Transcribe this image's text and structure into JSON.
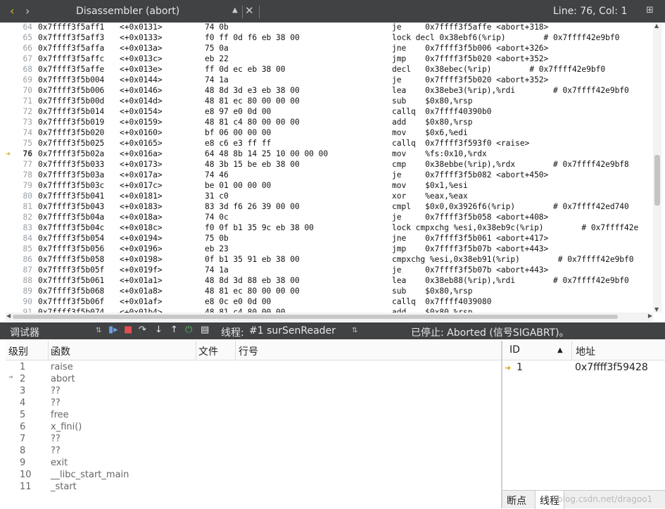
{
  "editor": {
    "title": "Disassembler (abort)",
    "position": "Line: 76, Col: 1",
    "rows": [
      {
        "ln": "64",
        "addr": "0x7ffff3f5aff1",
        "off": "<+0x0131>",
        "bytes": "74 0b",
        "ins": "je     0x7ffff3f5affe <abort+318>"
      },
      {
        "ln": "65",
        "addr": "0x7ffff3f5aff3",
        "off": "<+0x0133>",
        "bytes": "f0 ff 0d f6 eb 38 00",
        "ins": "lock decl 0x38ebf6(%rip)        # 0x7ffff42e9bf0"
      },
      {
        "ln": "66",
        "addr": "0x7ffff3f5affa",
        "off": "<+0x013a>",
        "bytes": "75 0a",
        "ins": "jne    0x7ffff3f5b006 <abort+326>"
      },
      {
        "ln": "67",
        "addr": "0x7ffff3f5affc",
        "off": "<+0x013c>",
        "bytes": "eb 22",
        "ins": "jmp    0x7ffff3f5b020 <abort+352>"
      },
      {
        "ln": "68",
        "addr": "0x7ffff3f5affe",
        "off": "<+0x013e>",
        "bytes": "ff 0d ec eb 38 00",
        "ins": "decl   0x38ebec(%rip)        # 0x7ffff42e9bf0"
      },
      {
        "ln": "69",
        "addr": "0x7ffff3f5b004",
        "off": "<+0x0144>",
        "bytes": "74 1a",
        "ins": "je     0x7ffff3f5b020 <abort+352>"
      },
      {
        "ln": "70",
        "addr": "0x7ffff3f5b006",
        "off": "<+0x0146>",
        "bytes": "48 8d 3d e3 eb 38 00",
        "ins": "lea    0x38ebe3(%rip),%rdi        # 0x7ffff42e9bf0"
      },
      {
        "ln": "71",
        "addr": "0x7ffff3f5b00d",
        "off": "<+0x014d>",
        "bytes": "48 81 ec 80 00 00 00",
        "ins": "sub    $0x80,%rsp"
      },
      {
        "ln": "72",
        "addr": "0x7ffff3f5b014",
        "off": "<+0x0154>",
        "bytes": "e8 97 e0 0d 00",
        "ins": "callq  0x7ffff40390b0"
      },
      {
        "ln": "73",
        "addr": "0x7ffff3f5b019",
        "off": "<+0x0159>",
        "bytes": "48 81 c4 80 00 00 00",
        "ins": "add    $0x80,%rsp"
      },
      {
        "ln": "74",
        "addr": "0x7ffff3f5b020",
        "off": "<+0x0160>",
        "bytes": "bf 06 00 00 00",
        "ins": "mov    $0x6,%edi"
      },
      {
        "ln": "75",
        "addr": "0x7ffff3f5b025",
        "off": "<+0x0165>",
        "bytes": "e8 c6 e3 ff ff",
        "ins": "callq  0x7ffff3f593f0 <raise>"
      },
      {
        "ln": "76",
        "addr": "0x7ffff3f5b02a",
        "off": "<+0x016a>",
        "bytes": "64 48 8b 14 25 10 00 00 00",
        "ins": "mov    %fs:0x10,%rdx"
      },
      {
        "ln": "77",
        "addr": "0x7ffff3f5b033",
        "off": "<+0x0173>",
        "bytes": "48 3b 15 be eb 38 00",
        "ins": "cmp    0x38ebbe(%rip),%rdx        # 0x7ffff42e9bf8"
      },
      {
        "ln": "78",
        "addr": "0x7ffff3f5b03a",
        "off": "<+0x017a>",
        "bytes": "74 46",
        "ins": "je     0x7ffff3f5b082 <abort+450>"
      },
      {
        "ln": "79",
        "addr": "0x7ffff3f5b03c",
        "off": "<+0x017c>",
        "bytes": "be 01 00 00 00",
        "ins": "mov    $0x1,%esi"
      },
      {
        "ln": "80",
        "addr": "0x7ffff3f5b041",
        "off": "<+0x0181>",
        "bytes": "31 c0",
        "ins": "xor    %eax,%eax"
      },
      {
        "ln": "81",
        "addr": "0x7ffff3f5b043",
        "off": "<+0x0183>",
        "bytes": "83 3d f6 26 39 00 00",
        "ins": "cmpl   $0x0,0x3926f6(%rip)        # 0x7ffff42ed740"
      },
      {
        "ln": "82",
        "addr": "0x7ffff3f5b04a",
        "off": "<+0x018a>",
        "bytes": "74 0c",
        "ins": "je     0x7ffff3f5b058 <abort+408>"
      },
      {
        "ln": "83",
        "addr": "0x7ffff3f5b04c",
        "off": "<+0x018c>",
        "bytes": "f0 0f b1 35 9c eb 38 00",
        "ins": "lock cmpxchg %esi,0x38eb9c(%rip)        # 0x7ffff42e"
      },
      {
        "ln": "84",
        "addr": "0x7ffff3f5b054",
        "off": "<+0x0194>",
        "bytes": "75 0b",
        "ins": "jne    0x7ffff3f5b061 <abort+417>"
      },
      {
        "ln": "85",
        "addr": "0x7ffff3f5b056",
        "off": "<+0x0196>",
        "bytes": "eb 23",
        "ins": "jmp    0x7ffff3f5b07b <abort+443>"
      },
      {
        "ln": "86",
        "addr": "0x7ffff3f5b058",
        "off": "<+0x0198>",
        "bytes": "0f b1 35 91 eb 38 00",
        "ins": "cmpxchg %esi,0x38eb91(%rip)        # 0x7ffff42e9bf0"
      },
      {
        "ln": "87",
        "addr": "0x7ffff3f5b05f",
        "off": "<+0x019f>",
        "bytes": "74 1a",
        "ins": "je     0x7ffff3f5b07b <abort+443>"
      },
      {
        "ln": "88",
        "addr": "0x7ffff3f5b061",
        "off": "<+0x01a1>",
        "bytes": "48 8d 3d 88 eb 38 00",
        "ins": "lea    0x38eb88(%rip),%rdi        # 0x7ffff42e9bf0"
      },
      {
        "ln": "89",
        "addr": "0x7ffff3f5b068",
        "off": "<+0x01a8>",
        "bytes": "48 81 ec 80 00 00 00",
        "ins": "sub    $0x80,%rsp"
      },
      {
        "ln": "90",
        "addr": "0x7ffff3f5b06f",
        "off": "<+0x01af>",
        "bytes": "e8 0c e0 0d 00",
        "ins": "callq  0x7ffff4039080"
      },
      {
        "ln": "91",
        "addr": "0x7ffff3f5b074",
        "off": "<+0x01b4>",
        "bytes": "48 81 c4 80 00 00",
        "ins": "add    $0x80,%rsp"
      }
    ],
    "current_line": "76"
  },
  "debugger": {
    "mode_label": "调试器",
    "thread_label": "线程:",
    "thread_value": "#1 surSenReader",
    "status": "已停止: Aborted (信号SIGABRT)。",
    "stack_headers": {
      "level": "级别",
      "function": "函数",
      "file": "文件",
      "line": "行号"
    },
    "frames": [
      {
        "level": "1",
        "function": "raise"
      },
      {
        "level": "2",
        "function": "abort"
      },
      {
        "level": "3",
        "function": "??"
      },
      {
        "level": "4",
        "function": "??"
      },
      {
        "level": "5",
        "function": "free"
      },
      {
        "level": "6",
        "function": "x_fini()"
      },
      {
        "level": "7",
        "function": "??"
      },
      {
        "level": "8",
        "function": "??"
      },
      {
        "level": "9",
        "function": "exit"
      },
      {
        "level": "10",
        "function": "__libc_start_main"
      },
      {
        "level": "11",
        "function": "_start"
      }
    ],
    "current_frame": "2",
    "threads_headers": {
      "id": "ID",
      "address": "地址"
    },
    "threads": [
      {
        "id": "1",
        "address": "0x7ffff3f59428"
      }
    ],
    "tabs": [
      "断点",
      "线程"
    ],
    "watermark": "blog.csdn.net/dragoo1"
  },
  "colors": {
    "bar": "#404244",
    "arrow": "#d9a31a"
  }
}
